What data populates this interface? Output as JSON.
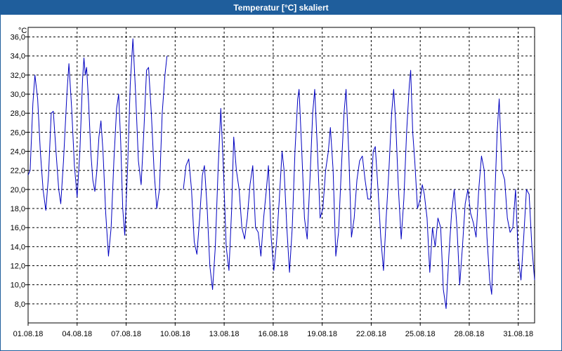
{
  "window": {
    "title": "Temperatur [°C] skaliert"
  },
  "colors": {
    "titlebar": "#1f5e9c",
    "series": "#0000c0",
    "grid": "#000000"
  },
  "chart_data": {
    "type": "line",
    "title": "Temperatur [°C] skaliert",
    "ylabel": "°C",
    "xlabel": "",
    "ylim": [
      6.0,
      37.0
    ],
    "xlim": [
      "01.08.18",
      "01.09.18"
    ],
    "grid": true,
    "legend": "none",
    "y_ticks": [
      "8,0",
      "10,0",
      "12,0",
      "14,0",
      "16,0",
      "18,0",
      "20,0",
      "22,0",
      "24,0",
      "26,0",
      "28,0",
      "30,0",
      "32,0",
      "34,0",
      "36,0"
    ],
    "x_ticks": [
      "01.08.18",
      "04.08.18",
      "07.08.18",
      "10.08.18",
      "13.08.18",
      "16.08.18",
      "19.08.18",
      "22.08.18",
      "25.08.18",
      "28.08.18",
      "31.08.18"
    ],
    "series": [
      {
        "values": [
          [
            "01.08.18 00:00",
            21.5
          ],
          [
            "01.08.18 03:00",
            22.0
          ],
          [
            "01.08.18 07:00",
            29.0
          ],
          [
            "01.08.18 10:00",
            32.0
          ],
          [
            "01.08.18 14:00",
            29.5
          ],
          [
            "01.08.18 18:00",
            24.0
          ],
          [
            "01.08.18 22:00",
            20.0
          ],
          [
            "02.08.18 02:00",
            17.8
          ],
          [
            "02.08.18 06:00",
            21.5
          ],
          [
            "02.08.18 10:00",
            28.0
          ],
          [
            "02.08.18 13:00",
            28.2
          ],
          [
            "02.08.18 17:00",
            24.0
          ],
          [
            "02.08.18 21:00",
            20.0
          ],
          [
            "03.08.18 00:00",
            18.5
          ],
          [
            "03.08.18 04:00",
            23.0
          ],
          [
            "03.08.18 09:00",
            30.0
          ],
          [
            "03.08.18 12:00",
            33.2
          ],
          [
            "03.08.18 16:00",
            28.5
          ],
          [
            "03.08.18 20:00",
            22.5
          ],
          [
            "04.08.18 00:00",
            19.2
          ],
          [
            "04.08.18 04:00",
            24.0
          ],
          [
            "04.08.18 08:00",
            31.5
          ],
          [
            "04.08.18 10:00",
            33.8
          ],
          [
            "04.08.18 12:00",
            32.0
          ],
          [
            "04.08.18 14:00",
            32.8
          ],
          [
            "04.08.18 17:00",
            29.0
          ],
          [
            "04.08.18 20:00",
            24.0
          ],
          [
            "04.08.18 23:00",
            21.0
          ],
          [
            "05.08.18 02:00",
            19.8
          ],
          [
            "05.08.18 05:00",
            22.0
          ],
          [
            "05.08.18 08:00",
            25.5
          ],
          [
            "05.08.18 11:00",
            27.2
          ],
          [
            "05.08.18 14:00",
            24.0
          ],
          [
            "05.08.18 18:00",
            17.5
          ],
          [
            "05.08.18 22:00",
            13.0
          ],
          [
            "06.08.18 02:00",
            16.0
          ],
          [
            "06.08.18 06:00",
            23.0
          ],
          [
            "06.08.18 10:00",
            28.5
          ],
          [
            "06.08.18 13:00",
            30.0
          ],
          [
            "06.08.18 16:00",
            25.0
          ],
          [
            "06.08.18 19:00",
            18.0
          ],
          [
            "06.08.18 22:00",
            15.2
          ],
          [
            "07.08.18 02:00",
            22.0
          ],
          [
            "07.08.18 06:00",
            31.0
          ],
          [
            "07.08.18 10:00",
            35.8
          ],
          [
            "07.08.18 14:00",
            30.0
          ],
          [
            "07.08.18 18:00",
            23.0
          ],
          [
            "07.08.18 22:00",
            20.5
          ],
          [
            "08.08.18 02:00",
            26.0
          ],
          [
            "08.08.18 06:00",
            32.5
          ],
          [
            "08.08.18 09:00",
            32.8
          ],
          [
            "08.08.18 13:00",
            28.0
          ],
          [
            "08.08.18 17:00",
            22.0
          ],
          [
            "08.08.18 21:00",
            18.0
          ],
          [
            "09.08.18 01:00",
            20.0
          ],
          [
            "09.08.18 05:00",
            28.0
          ],
          [
            "09.08.18 09:00",
            32.0
          ],
          [
            "09.08.18 12:00",
            34.0
          ]
        ]
      },
      {
        "values": [
          [
            "10.08.18 12:00",
            20.0
          ],
          [
            "10.08.18 16:00",
            22.5
          ],
          [
            "10.08.18 20:00",
            23.2
          ],
          [
            "11.08.18 00:00",
            20.0
          ],
          [
            "11.08.18 04:00",
            14.5
          ],
          [
            "11.08.18 08:00",
            13.2
          ],
          [
            "11.08.18 12:00",
            17.0
          ],
          [
            "11.08.18 16:00",
            21.5
          ],
          [
            "11.08.18 19:00",
            22.5
          ],
          [
            "11.08.18 23:00",
            18.0
          ],
          [
            "12.08.18 03:00",
            12.0
          ],
          [
            "12.08.18 07:00",
            9.5
          ],
          [
            "12.08.18 11:00",
            14.0
          ],
          [
            "12.08.18 15:00",
            22.0
          ],
          [
            "12.08.18 19:00",
            28.5
          ],
          [
            "12.08.18 23:00",
            22.0
          ],
          [
            "13.08.18 03:00",
            14.0
          ],
          [
            "13.08.18 07:00",
            11.5
          ],
          [
            "13.08.18 11:00",
            18.0
          ],
          [
            "13.08.18 14:00",
            25.5
          ],
          [
            "13.08.18 18:00",
            22.0
          ],
          [
            "13.08.18 22:00",
            20.0
          ],
          [
            "14.08.18 02:00",
            16.0
          ],
          [
            "14.08.18 06:00",
            14.8
          ],
          [
            "14.08.18 10:00",
            17.0
          ],
          [
            "14.08.18 14:00",
            20.5
          ],
          [
            "14.08.18 18:00",
            22.5
          ],
          [
            "14.08.18 22:00",
            16.0
          ],
          [
            "15.08.18 02:00",
            15.5
          ],
          [
            "15.08.18 06:00",
            13.0
          ],
          [
            "15.08.18 10:00",
            17.0
          ],
          [
            "15.08.18 14:00",
            20.0
          ],
          [
            "15.08.18 17:00",
            22.5
          ],
          [
            "15.08.18 21:00",
            15.0
          ],
          [
            "16.08.18 01:00",
            11.5
          ],
          [
            "16.08.18 05:00",
            14.5
          ],
          [
            "16.08.18 09:00",
            19.0
          ],
          [
            "16.08.18 13:00",
            24.0
          ],
          [
            "16.08.18 16:00",
            22.0
          ],
          [
            "16.08.18 20:00",
            16.0
          ],
          [
            "17.08.18 00:00",
            11.3
          ],
          [
            "17.08.18 04:00",
            16.0
          ],
          [
            "17.08.18 08:00",
            24.0
          ],
          [
            "17.08.18 12:00",
            29.5
          ],
          [
            "17.08.18 14:00",
            30.5
          ],
          [
            "17.08.18 18:00",
            24.0
          ],
          [
            "17.08.18 22:00",
            17.0
          ],
          [
            "18.08.18 02:00",
            14.8
          ],
          [
            "18.08.18 06:00",
            21.0
          ],
          [
            "18.08.18 10:00",
            28.0
          ],
          [
            "18.08.18 13:00",
            30.5
          ],
          [
            "18.08.18 17:00",
            24.0
          ],
          [
            "18.08.18 21:00",
            17.0
          ],
          [
            "19.08.18 01:00",
            18.0
          ],
          [
            "19.08.18 05:00",
            22.0
          ],
          [
            "19.08.18 09:00",
            24.0
          ],
          [
            "19.08.18 12:00",
            26.5
          ],
          [
            "19.08.18 16:00",
            22.0
          ],
          [
            "19.08.18 20:00",
            13.0
          ],
          [
            "20.08.18 00:00",
            15.5
          ],
          [
            "20.08.18 04:00",
            22.0
          ],
          [
            "20.08.18 08:00",
            28.0
          ],
          [
            "20.08.18 11:00",
            30.5
          ],
          [
            "20.08.18 15:00",
            24.0
          ],
          [
            "20.08.18 19:00",
            15.0
          ],
          [
            "20.08.18 23:00",
            17.0
          ],
          [
            "21.08.18 03:00",
            21.0
          ],
          [
            "21.08.18 07:00",
            23.0
          ],
          [
            "21.08.18 11:00",
            23.5
          ],
          [
            "21.08.18 15:00",
            21.0
          ],
          [
            "21.08.18 19:00",
            19.0
          ],
          [
            "21.08.18 23:00",
            19.0
          ],
          [
            "22.08.18 03:00",
            24.0
          ],
          [
            "22.08.18 06:00",
            24.5
          ],
          [
            "22.08.18 10:00",
            20.0
          ],
          [
            "22.08.18 14:00",
            15.0
          ],
          [
            "22.08.18 18:00",
            11.5
          ],
          [
            "22.08.18 22:00",
            17.0
          ],
          [
            "23.08.18 02:00",
            22.0
          ],
          [
            "23.08.18 06:00",
            28.0
          ],
          [
            "23.08.18 09:00",
            30.5
          ],
          [
            "23.08.18 12:00",
            27.0
          ],
          [
            "23.08.18 16:00",
            20.0
          ],
          [
            "23.08.18 20:00",
            14.8
          ],
          [
            "24.08.18 00:00",
            19.0
          ],
          [
            "24.08.18 04:00",
            26.0
          ],
          [
            "24.08.18 08:00",
            31.0
          ],
          [
            "24.08.18 10:00",
            32.5
          ],
          [
            "24.08.18 13:00",
            26.0
          ],
          [
            "24.08.18 16:00",
            23.0
          ],
          [
            "24.08.18 20:00",
            18.0
          ],
          [
            "25.08.18 00:00",
            19.0
          ],
          [
            "25.08.18 03:00",
            20.5
          ],
          [
            "25.08.18 06:00",
            19.5
          ],
          [
            "25.08.18 10:00",
            17.0
          ],
          [
            "25.08.18 14:00",
            11.3
          ],
          [
            "25.08.18 18:00",
            16.0
          ],
          [
            "25.08.18 22:00",
            14.0
          ],
          [
            "26.08.18 02:00",
            17.0
          ],
          [
            "26.08.18 06:00",
            16.0
          ],
          [
            "26.08.18 10:00",
            9.5
          ],
          [
            "26.08.18 14:00",
            7.5
          ],
          [
            "26.08.18 18:00",
            13.0
          ],
          [
            "26.08.18 22:00",
            17.5
          ],
          [
            "27.08.18 02:00",
            20.0
          ],
          [
            "27.08.18 06:00",
            16.0
          ],
          [
            "27.08.18 10:00",
            10.0
          ],
          [
            "27.08.18 14:00",
            14.0
          ],
          [
            "27.08.18 18:00",
            18.5
          ],
          [
            "27.08.18 22:00",
            20.0
          ],
          [
            "28.08.18 02:00",
            17.5
          ],
          [
            "28.08.18 06:00",
            16.5
          ],
          [
            "28.08.18 10:00",
            15.0
          ],
          [
            "28.08.18 14:00",
            20.0
          ],
          [
            "28.08.18 18:00",
            23.5
          ],
          [
            "28.08.18 22:00",
            22.0
          ],
          [
            "29.08.18 02:00",
            15.0
          ],
          [
            "29.08.18 06:00",
            10.5
          ],
          [
            "29.08.18 09:00",
            9.0
          ],
          [
            "29.08.18 13:00",
            18.0
          ],
          [
            "29.08.18 17:00",
            26.0
          ],
          [
            "29.08.18 20:00",
            29.5
          ],
          [
            "30.08.18 00:00",
            22.0
          ],
          [
            "30.08.18 04:00",
            21.0
          ],
          [
            "30.08.18 08:00",
            17.0
          ],
          [
            "30.08.18 12:00",
            15.5
          ],
          [
            "30.08.18 16:00",
            16.0
          ],
          [
            "30.08.18 20:00",
            20.0
          ],
          [
            "31.08.18 00:00",
            13.0
          ],
          [
            "31.08.18 04:00",
            10.5
          ],
          [
            "31.08.18 08:00",
            15.0
          ],
          [
            "31.08.18 12:00",
            20.0
          ],
          [
            "31.08.18 16:00",
            19.5
          ],
          [
            "31.08.18 20:00",
            14.0
          ],
          [
            "01.09.18 00:00",
            10.5
          ]
        ]
      }
    ]
  }
}
